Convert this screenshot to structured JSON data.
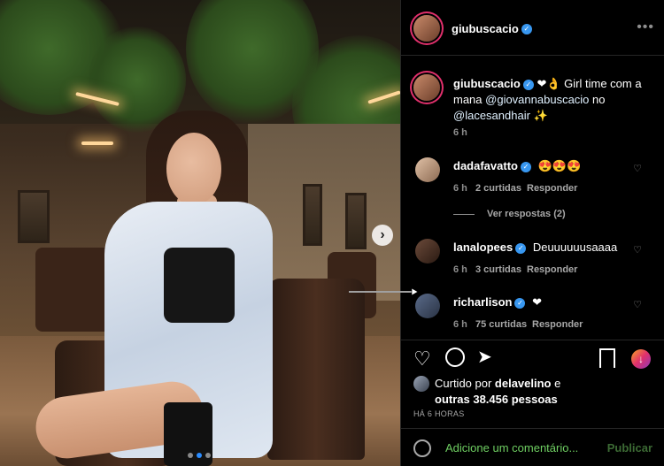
{
  "post": {
    "author": "giubuscacio",
    "next_icon": "chevron-right-icon",
    "carousel": {
      "count": 3,
      "active": 1
    }
  },
  "caption": {
    "author": "giubuscacio",
    "text_a": "❤👌 Girl time com a mana ",
    "mention_1": "@giovannabuscacio",
    "text_b": " no ",
    "mention_2": "@lacesandhair",
    "text_c": " ✨",
    "time": "6 h"
  },
  "comments": [
    {
      "user": "dadafavatto",
      "verified": true,
      "text": "😍😍😍",
      "time": "6 h",
      "likes": "2 curtidas",
      "reply": "Responder",
      "view_replies": "Ver respostas (2)"
    },
    {
      "user": "lanalopees",
      "verified": true,
      "text": "Deuuuuuusaaaa",
      "time": "6 h",
      "likes": "3 curtidas",
      "reply": "Responder"
    },
    {
      "user": "richarlison",
      "verified": true,
      "text": "❤",
      "time": "6 h",
      "likes": "75 curtidas",
      "reply": "Responder"
    }
  ],
  "actions": {
    "liked_by_prefix": "Curtido por ",
    "liked_by_user": "delavelino",
    "liked_by_suffix": " e",
    "others": "outras 38.456 pessoas",
    "date": "HÁ 6 HORAS"
  },
  "add_comment": {
    "placeholder": "Adicione um comentário...",
    "publish": "Publicar"
  },
  "colors": {
    "accent": "#3897f0",
    "verified": "#3897f0"
  }
}
